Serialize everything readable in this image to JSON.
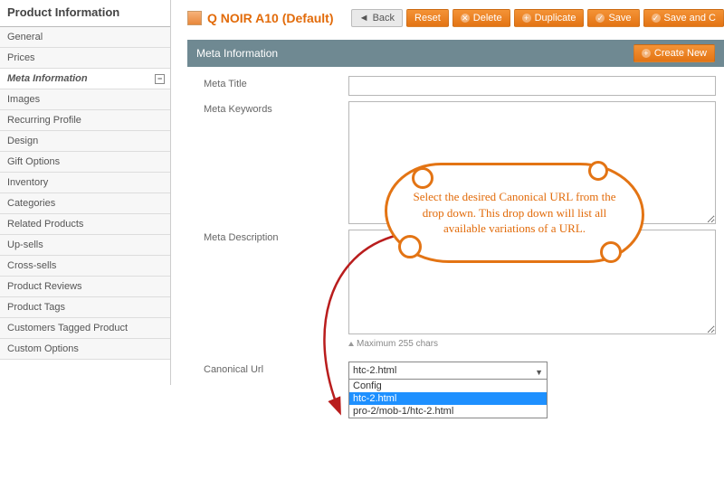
{
  "sidebar": {
    "title": "Product Information",
    "items": [
      {
        "label": "General"
      },
      {
        "label": "Prices"
      },
      {
        "label": "Meta Information"
      },
      {
        "label": "Images"
      },
      {
        "label": "Recurring Profile"
      },
      {
        "label": "Design"
      },
      {
        "label": "Gift Options"
      },
      {
        "label": "Inventory"
      },
      {
        "label": "Categories"
      },
      {
        "label": "Related Products"
      },
      {
        "label": "Up-sells"
      },
      {
        "label": "Cross-sells"
      },
      {
        "label": "Product Reviews"
      },
      {
        "label": "Product Tags"
      },
      {
        "label": "Customers Tagged Product"
      },
      {
        "label": "Custom Options"
      }
    ],
    "active_index": 2
  },
  "header": {
    "title": "Q NOIR A10 (Default)",
    "buttons": {
      "back": "Back",
      "reset": "Reset",
      "delete": "Delete",
      "duplicate": "Duplicate",
      "save": "Save",
      "save_continue": "Save and C"
    }
  },
  "panel": {
    "title": "Meta Information",
    "create_new": "Create New"
  },
  "form": {
    "meta_title": {
      "label": "Meta Title",
      "value": ""
    },
    "meta_keywords": {
      "label": "Meta Keywords",
      "value": ""
    },
    "meta_description": {
      "label": "Meta Description",
      "value": ""
    },
    "meta_description_helper": "Maximum 255 chars",
    "canonical": {
      "label": "Canonical Url",
      "value": "htc-2.html",
      "options": [
        "Config",
        "htc-2.html",
        "pro-2/mob-1/htc-2.html"
      ],
      "selected_index": 1
    }
  },
  "callout": {
    "text": "Select the desired Canonical URL from the drop down. This drop down will list all available variations of a URL."
  }
}
